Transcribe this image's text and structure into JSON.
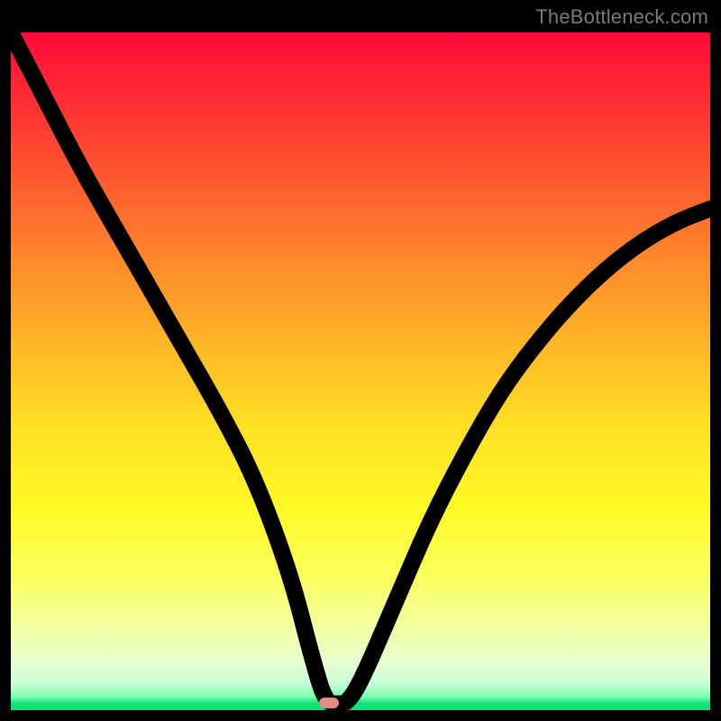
{
  "watermark": {
    "text": "TheBottleneck.com"
  },
  "colors": {
    "marker": "#e38b86",
    "curve": "#000000",
    "plot_border": "#000000"
  },
  "marker": {
    "x_pct": 45.5,
    "y_pct": 99.0
  },
  "chart_data": {
    "type": "line",
    "title": "",
    "xlabel": "",
    "ylabel": "",
    "xlim": [
      0,
      100
    ],
    "ylim": [
      0,
      100
    ],
    "grid": false,
    "legend": false,
    "annotations": [],
    "series": [
      {
        "name": "bottleneck-curve",
        "x": [
          0,
          5,
          10,
          15,
          20,
          25,
          30,
          35,
          40,
          43,
          45,
          47,
          48,
          50,
          55,
          60,
          65,
          70,
          75,
          80,
          85,
          90,
          95,
          100
        ],
        "y": [
          100,
          90,
          80,
          71,
          62,
          53,
          44,
          34,
          20,
          8,
          1,
          1,
          1,
          4,
          16,
          28,
          38,
          47,
          54,
          60,
          65,
          69,
          72,
          74
        ]
      }
    ],
    "note": "Values estimated from pixel positions; y is percent height of the V-shaped curve above the green baseline. The valley sits near x≈45–47 at y≈1."
  }
}
